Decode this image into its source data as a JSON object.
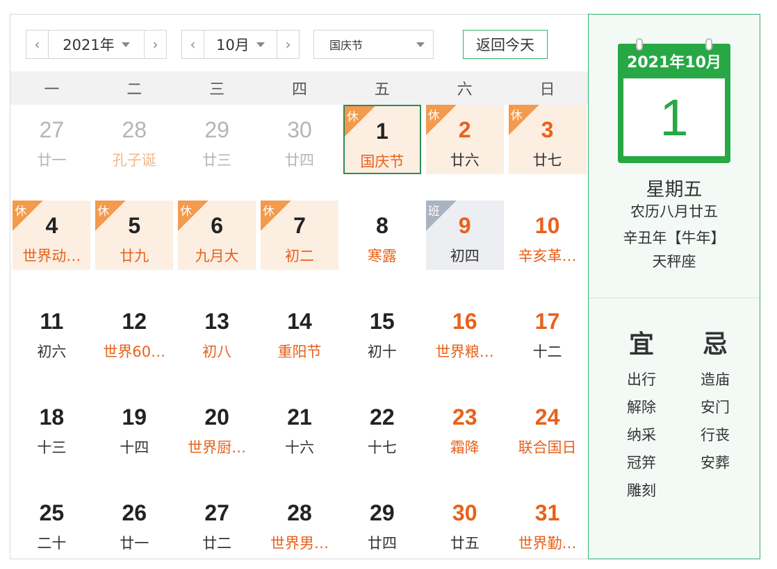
{
  "toolbar": {
    "year": "2021年",
    "month": "10月",
    "holiday": "国庆节",
    "today_label": "返回今天"
  },
  "weekdays": [
    "一",
    "二",
    "三",
    "四",
    "五",
    "六",
    "日"
  ],
  "badges": {
    "rest": "休",
    "work": "班"
  },
  "weeks": [
    [
      {
        "d": "27",
        "s": "廿一",
        "other": true
      },
      {
        "d": "28",
        "s": "孔子诞",
        "other": true,
        "fest": true
      },
      {
        "d": "29",
        "s": "廿三",
        "other": true
      },
      {
        "d": "30",
        "s": "廿四",
        "other": true
      },
      {
        "d": "1",
        "s": "国庆节",
        "rest": true,
        "fest": true,
        "today": true
      },
      {
        "d": "2",
        "s": "廿六",
        "rest": true,
        "red": true
      },
      {
        "d": "3",
        "s": "廿七",
        "rest": true,
        "red": true
      }
    ],
    [
      {
        "d": "4",
        "s": "世界动…",
        "rest": true,
        "fest": true
      },
      {
        "d": "5",
        "s": "廿九",
        "rest": true,
        "fest": true
      },
      {
        "d": "6",
        "s": "九月大",
        "rest": true,
        "fest": true
      },
      {
        "d": "7",
        "s": "初二",
        "rest": true,
        "fest": true
      },
      {
        "d": "8",
        "s": "寒露",
        "fest": true
      },
      {
        "d": "9",
        "s": "初四",
        "work": true,
        "red": true
      },
      {
        "d": "10",
        "s": "辛亥革…",
        "red": true,
        "fest": true
      }
    ],
    [
      {
        "d": "11",
        "s": "初六"
      },
      {
        "d": "12",
        "s": "世界60…",
        "fest": true
      },
      {
        "d": "13",
        "s": "初八",
        "fest": true
      },
      {
        "d": "14",
        "s": "重阳节",
        "fest": true
      },
      {
        "d": "15",
        "s": "初十"
      },
      {
        "d": "16",
        "s": "世界粮…",
        "red": true,
        "fest": true
      },
      {
        "d": "17",
        "s": "十二",
        "red": true
      }
    ],
    [
      {
        "d": "18",
        "s": "十三"
      },
      {
        "d": "19",
        "s": "十四"
      },
      {
        "d": "20",
        "s": "世界厨…",
        "fest": true
      },
      {
        "d": "21",
        "s": "十六"
      },
      {
        "d": "22",
        "s": "十七"
      },
      {
        "d": "23",
        "s": "霜降",
        "red": true,
        "fest": true
      },
      {
        "d": "24",
        "s": "联合国日",
        "red": true,
        "fest": true
      }
    ],
    [
      {
        "d": "25",
        "s": "二十"
      },
      {
        "d": "26",
        "s": "廿一"
      },
      {
        "d": "27",
        "s": "廿二"
      },
      {
        "d": "28",
        "s": "世界男…",
        "fest": true
      },
      {
        "d": "29",
        "s": "廿四"
      },
      {
        "d": "30",
        "s": "廿五",
        "red": true
      },
      {
        "d": "31",
        "s": "世界勤…",
        "red": true,
        "fest": true
      }
    ]
  ],
  "detail": {
    "header": "2021年10月",
    "day": "1",
    "weekday": "星期五",
    "lunar": "农历八月廿五",
    "ganzhi": "辛丑年【牛年】",
    "zodiac": "天秤座",
    "yi_title": "宜",
    "ji_title": "忌",
    "yi": [
      "出行",
      "解除",
      "纳采",
      "冠笄",
      "雕刻"
    ],
    "ji": [
      "造庙",
      "安门",
      "行丧",
      "安葬"
    ]
  },
  "colors": {
    "accent": "#2bb36b",
    "festival": "#e8611a",
    "rest_bg": "#fdeee2",
    "rest_badge": "#f39a4c",
    "work_badge": "#a9b4c0"
  }
}
